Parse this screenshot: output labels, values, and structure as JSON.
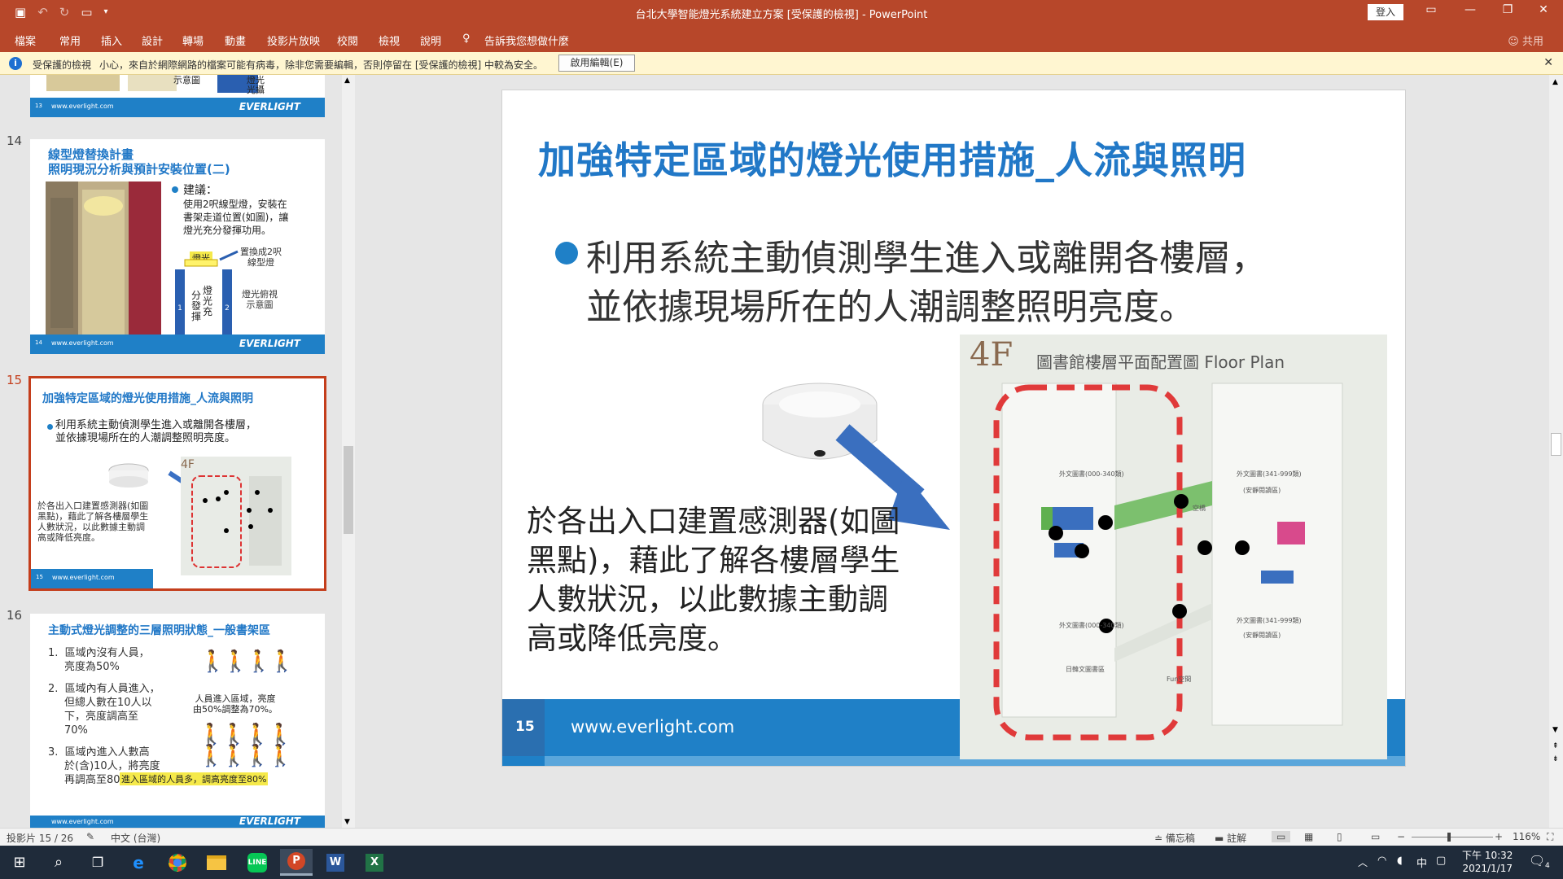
{
  "window": {
    "title": "台北大學智能燈光系統建立方案 [受保護的檢視] - PowerPoint",
    "signin": "登入",
    "controls": [
      "▭",
      "—",
      "❐",
      "✕"
    ]
  },
  "ribbon": {
    "tabs": [
      "檔案",
      "常用",
      "插入",
      "設計",
      "轉場",
      "動畫",
      "投影片放映",
      "校閱",
      "檢視",
      "說明"
    ],
    "tell_me": "告訴我您想做什麼",
    "share": "共用"
  },
  "protected_view": {
    "title": "受保護的檢視",
    "message": "小心，來自於網際網路的檔案可能有病毒，除非您需要編輯，否則停留在 [受保護的檢視] 中較為安全。",
    "enable_button": "啟用編輯(E)"
  },
  "thumbnails": {
    "footer_url": "www.everlight.com",
    "brand": "EVERLIGHT",
    "slide13": {
      "fragment1": "示意圖",
      "fragment2": "燈光",
      "fragment3": "光攝",
      "num": "13"
    },
    "slide14": {
      "num": "14",
      "title1": "線型燈替換計畫",
      "title2": "照明現況分析與預計安裝位置(二)",
      "bullet_head": "建議：",
      "bullet_text": [
        "使用2呎線型燈，安裝在",
        "書架走道位置(如圖)，讓",
        "燈光充分發揮功用。"
      ],
      "label_light": "燈光",
      "label_replace": [
        "置換成2呎",
        "線型燈"
      ],
      "label_view": [
        "燈光俯視",
        "示意圖"
      ],
      "label_spread": [
        "分",
        "發",
        "揮"
      ],
      "label_spread2": [
        "燈",
        "光",
        "充"
      ]
    },
    "slide15": {
      "num": "15",
      "title": "加強特定區域的燈光使用措施_人流與照明",
      "bullet": [
        "利用系統主動偵測學生進入或離開各樓層，",
        "並依據現場所在的人潮調整照明亮度。"
      ],
      "desc": [
        "於各出入口建置感測器(如圖",
        "黑點)，藉此了解各樓層學生",
        "人數狀況，以此數據主動調",
        "高或降低亮度。"
      ]
    },
    "slide16": {
      "num": "16",
      "title": "主動式燈光調整的三層照明狀態_一般書架區",
      "items": [
        [
          "區域內沒有人員，",
          "亮度為50%"
        ],
        [
          "區域內有人員進入，",
          "但總人數在10人以",
          "下，亮度調高至",
          "70%"
        ],
        [
          "區域內進入人數高",
          "於(含)10人，將亮度",
          "再調高至80%"
        ]
      ],
      "caption": [
        "人員進入區域，亮度",
        "由50%調整為70%。"
      ],
      "highlight": "進入區域的人員多，調高亮度至80%"
    }
  },
  "slide": {
    "title": "加強特定區域的燈光使用措施_人流與照明",
    "bullet_line1": "利用系統主動偵測學生進入或離開各樓層，",
    "bullet_line2": "並依據現場所在的人潮調整照明亮度。",
    "desc": [
      "於各出入口建置感測器(如圖",
      "黑點)，藉此了解各樓層學生",
      "人數狀況，以此數據主動調",
      "高或降低亮度。"
    ],
    "number": "15",
    "url": "www.everlight.com",
    "plan": {
      "floor": "4F",
      "title": "圖書館樓層平面配置圖 Floor Plan",
      "label_left_top": "外文圖書(000-340類)",
      "label_right_top": "外文圖書(341-999類)",
      "label_right_top2": "(安靜閱讀區)",
      "label_left_mid": "外文圖書(000-340類)",
      "label_right_mid": "外文圖書(341-999類)",
      "label_right_mid2": "(安靜閱讀區)",
      "label_left_bottom": "日韓文圖書區",
      "label_link": "空橋",
      "label_fun": "Fun空間"
    }
  },
  "status": {
    "slide_info": "投影片 15 / 26",
    "language": "中文 (台灣)",
    "notes": "備忘稿",
    "comments": "註解",
    "zoom": "116%"
  },
  "taskbar": {
    "time": "下午 10:32",
    "date": "2021/1/17",
    "ime": "中",
    "notif": "4"
  }
}
